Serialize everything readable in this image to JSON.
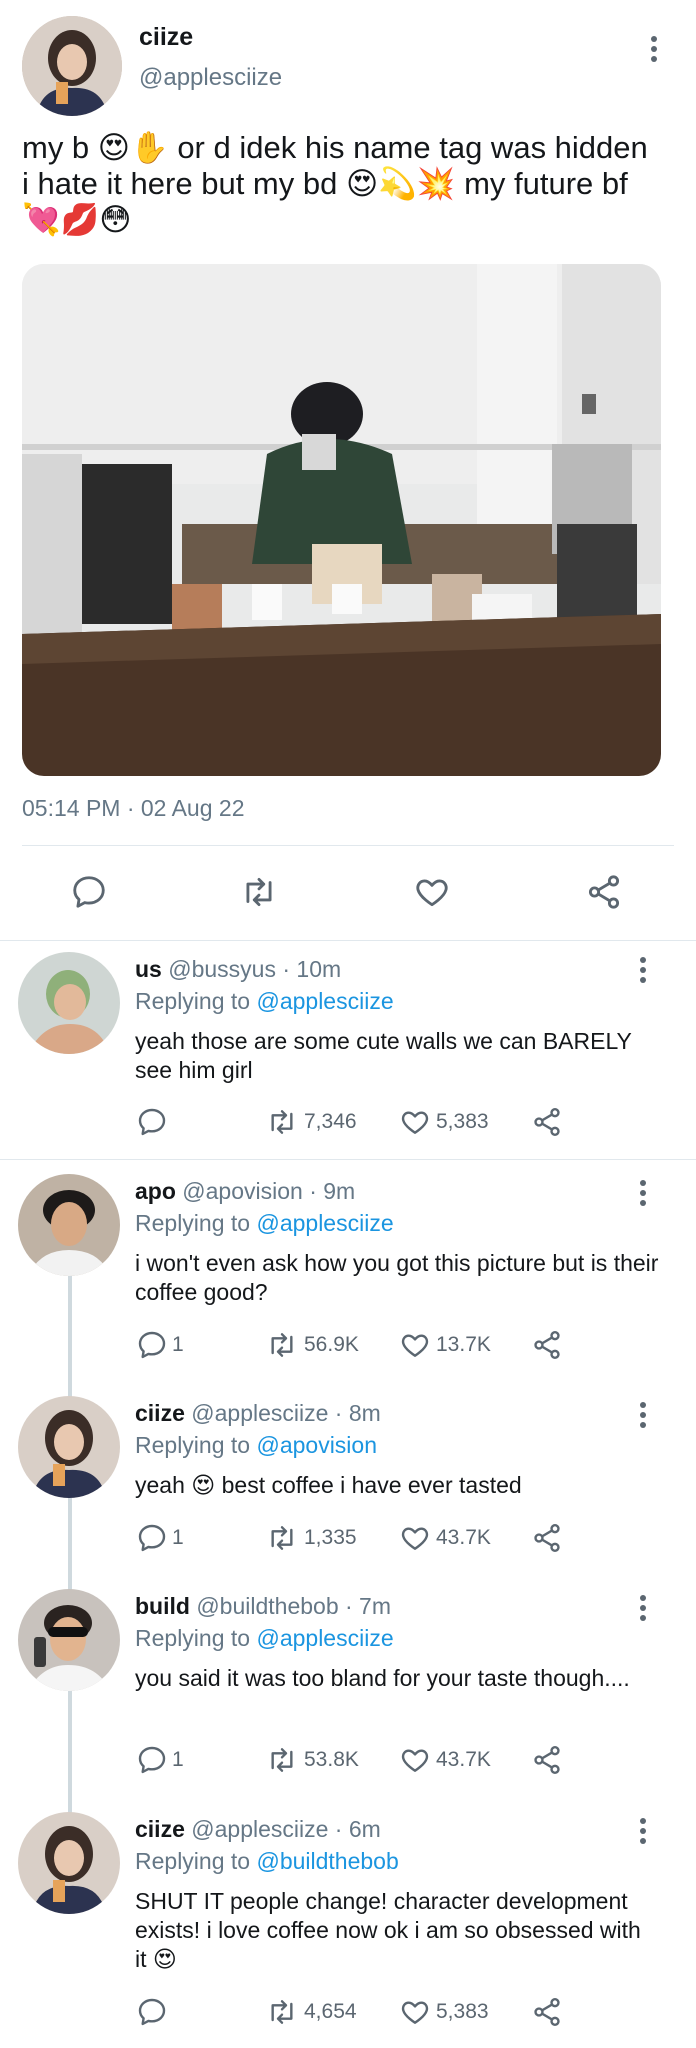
{
  "main_tweet": {
    "display_name": "ciize",
    "handle": "@applesciize",
    "text_line1": "my b 😍✋ or d idek his name tag was hidden",
    "text_line2": "i hate it here but my bd 😍💫💥 my future bf",
    "text_line3": "💘💋😳",
    "timestamp": "05:14 PM · 02 Aug 22"
  },
  "replies": [
    {
      "display_name": "us",
      "handle": "@bussyus · 10m",
      "replying_prefix": "Replying to ",
      "replying_to": "@applesciize",
      "text": "yeah those are some cute walls we can BARELY see him girl",
      "reply_count": "",
      "retweets": "7,346",
      "likes": "5,383"
    },
    {
      "display_name": "apo",
      "handle": "@apovision · 9m",
      "replying_prefix": "Replying to ",
      "replying_to": "@applesciize",
      "text": "i won't even ask how you got this picture but is their coffee good?",
      "reply_count": "1",
      "retweets": "56.9K",
      "likes": "13.7K"
    },
    {
      "display_name": "ciize",
      "handle": "@applesciize · 8m",
      "replying_prefix": "Replying to ",
      "replying_to": "@apovision",
      "text": "yeah 😍 best coffee i have ever tasted",
      "reply_count": "1",
      "retweets": "1,335",
      "likes": "43.7K"
    },
    {
      "display_name": "build",
      "handle": "@buildthebob · 7m",
      "replying_prefix": "Replying to ",
      "replying_to": "@applesciize",
      "text": "you said it was too bland for your taste though....",
      "reply_count": "1",
      "retweets": "53.8K",
      "likes": "43.7K"
    },
    {
      "display_name": "ciize",
      "handle": "@applesciize · 6m",
      "replying_prefix": "Replying to ",
      "replying_to": "@buildthebob",
      "text": "SHUT IT people change! character development exists! i love coffee now ok i am so obsessed with it 😍",
      "reply_count": "",
      "retweets": "4,654",
      "likes": "5,383"
    }
  ],
  "icons": {
    "reply": "speech-bubble-icon",
    "retweet": "retweet-arrows-icon",
    "like": "heart-icon",
    "share": "share-icon",
    "more": "more-vertical-icon"
  },
  "colors": {
    "link": "#1b95e0",
    "muted": "#657786",
    "divider": "#e1e8ed"
  }
}
